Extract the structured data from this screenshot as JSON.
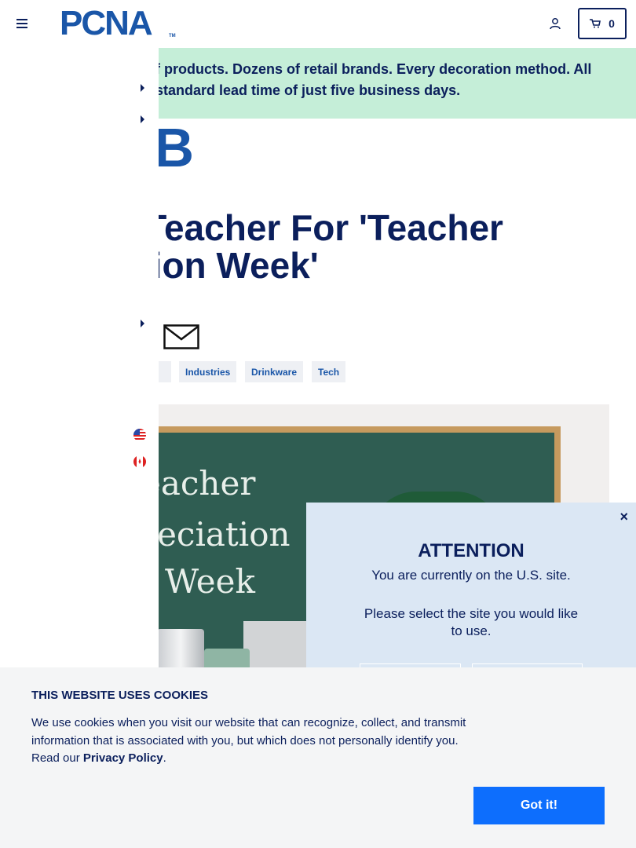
{
  "header": {
    "logo_text": "PCNA",
    "logo_tm": "TM",
    "cart_count": "0"
  },
  "banner": {
    "line1": "...ds of products. Dozens of retail brands. Every decoration method. All",
    "line2": "...th a standard lead time of just five business days."
  },
  "hub_logo": "UB",
  "article": {
    "title_line1": "A Teacher For 'Teacher",
    "title_line2": "iation Week'"
  },
  "tags": [
    "s",
    "Industries",
    "Drinkware",
    "Tech"
  ],
  "hero": {
    "chalk_line1": "eacher",
    "chalk_line2": "reciation",
    "chalk_line3": "Week"
  },
  "modal": {
    "title": "ATTENTION",
    "message": "You are currently on the U.S. site.",
    "prompt": "Please select the site you would like to use.",
    "close": "×"
  },
  "cookies": {
    "title": "THIS WEBSITE USES COOKIES",
    "text": "We use cookies when you visit our website that can recognize, collect, and transmit information that is associated with you, but which does not personally identify you. Read our ",
    "link": "Privacy Policy",
    "after_link": ".",
    "button": "Got it!"
  },
  "icons": {
    "menu": "hamburger-icon",
    "user": "user-icon",
    "cart": "cart-icon",
    "mail": "mail-icon",
    "us_flag": "us-flag-icon",
    "ca_flag": "canada-flag-icon"
  },
  "colors": {
    "navy": "#0b1f5c",
    "brand_blue": "#1a56a8",
    "banner_green": "#c5eed8",
    "modal_bg": "#dbe7f4",
    "cookie_button": "#0d6efd"
  }
}
